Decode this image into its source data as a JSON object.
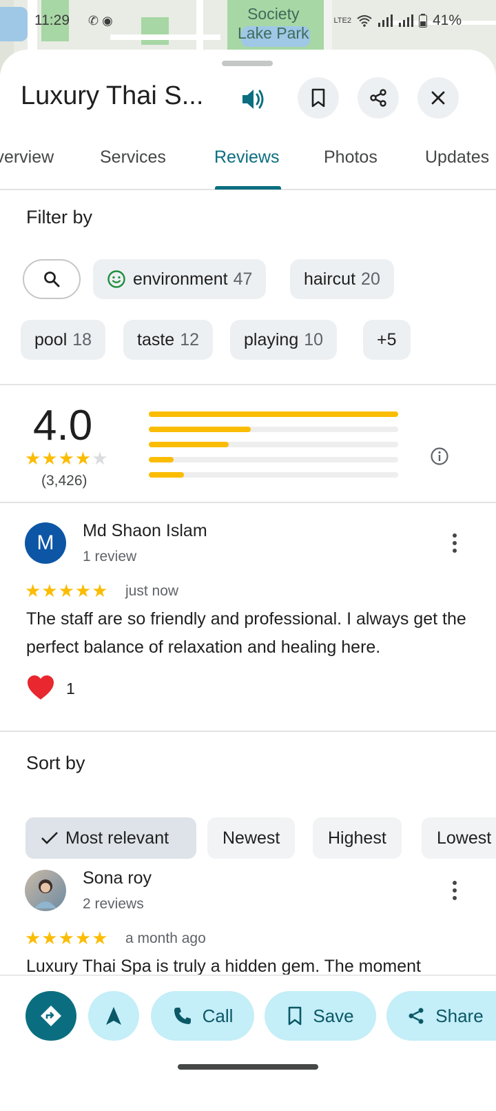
{
  "status_bar": {
    "time": "11:29",
    "apps": "✆ ◉",
    "signal": "LTE2",
    "battery": "41%"
  },
  "map": {
    "park_label_line1": "Society",
    "park_label_line2": "Lake Park"
  },
  "header": {
    "title": "Luxury Thai S..."
  },
  "tabs": [
    {
      "label": "Overview"
    },
    {
      "label": "Services"
    },
    {
      "label": "Reviews"
    },
    {
      "label": "Photos"
    },
    {
      "label": "Updates"
    }
  ],
  "filter": {
    "title": "Filter by",
    "chips": [
      {
        "label": "environment",
        "count": "47"
      },
      {
        "label": "haircut",
        "count": "20"
      },
      {
        "label": "pool",
        "count": "18"
      },
      {
        "label": "taste",
        "count": "12"
      },
      {
        "label": "playing",
        "count": "10"
      },
      {
        "label": "+5",
        "count": ""
      }
    ]
  },
  "summary": {
    "rating": "4.0",
    "count": "(3,426)",
    "distribution": [
      {
        "stars": 5,
        "fraction": 1.0
      },
      {
        "stars": 4,
        "fraction": 0.41
      },
      {
        "stars": 3,
        "fraction": 0.32
      },
      {
        "stars": 2,
        "fraction": 0.1
      },
      {
        "stars": 1,
        "fraction": 0.14
      }
    ]
  },
  "reviews": [
    {
      "initial": "M",
      "name": "Md Shaon Islam",
      "sub": "1 review",
      "stars": "★★★★★",
      "time": "just now",
      "text": "The staff are so friendly and professional. I always get the perfect balance of relaxation and healing here.",
      "likes": "1"
    },
    {
      "name": "Sona roy",
      "sub": "2 reviews",
      "stars": "★★★★★",
      "time": "a month ago",
      "text": "Luxury Thai Spa is truly a hidden gem. The moment"
    }
  ],
  "sort": {
    "title": "Sort by",
    "options": [
      {
        "label": "Most relevant"
      },
      {
        "label": "Newest"
      },
      {
        "label": "Highest"
      },
      {
        "label": "Lowest"
      }
    ]
  },
  "actions": {
    "call": "Call",
    "save": "Save",
    "share": "Share"
  },
  "colors": {
    "accent": "#0b6e80",
    "star": "#fbbc04",
    "action_bg": "#c4eef8"
  }
}
